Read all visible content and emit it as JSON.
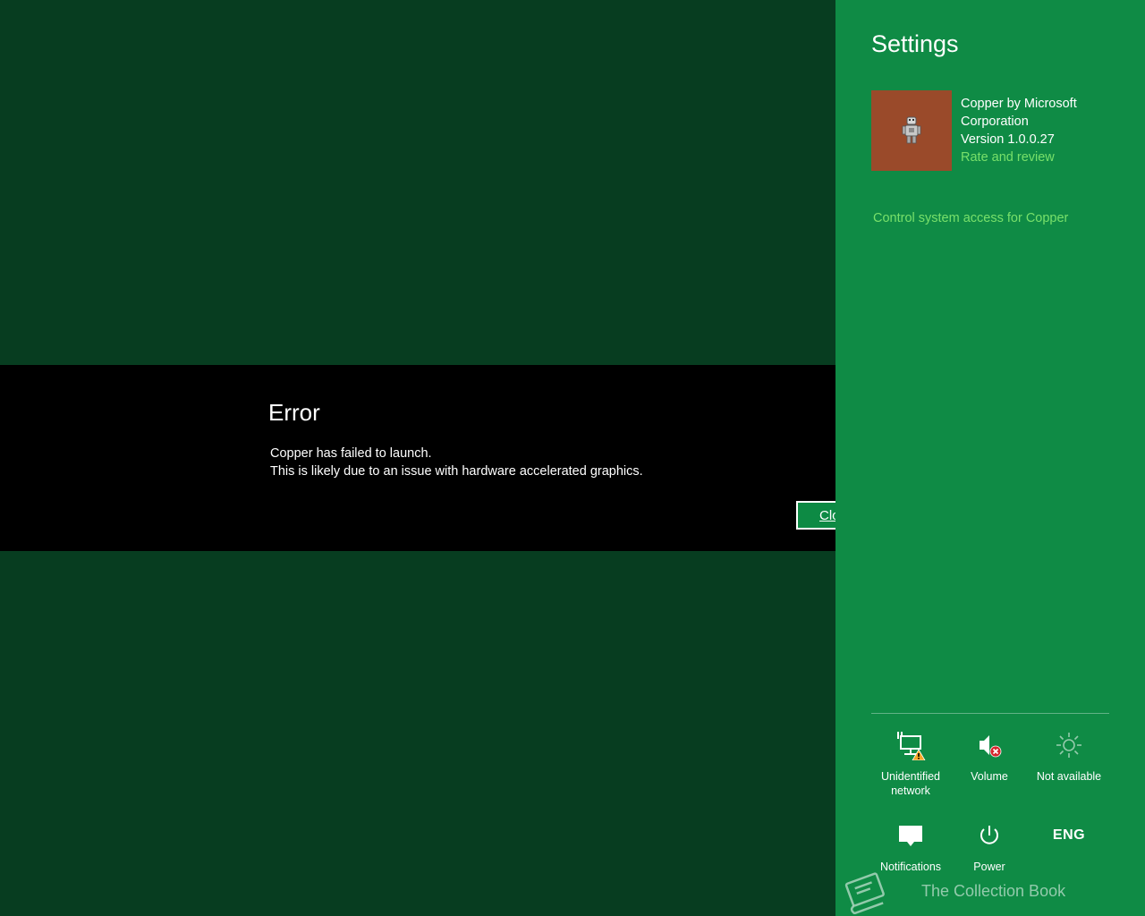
{
  "error_dialog": {
    "title": "Error",
    "message_line1": "Copper has failed to launch.",
    "message_line2": "This is likely due to an issue with hardware accelerated graphics.",
    "close_button_label": "Close"
  },
  "settings": {
    "title": "Settings",
    "app": {
      "name_line1": "Copper by Microsoft",
      "name_line2": "Corporation",
      "version": "Version 1.0.0.27",
      "rate_link": "Rate and review",
      "tile_icon": "robot-icon"
    },
    "access_link": "Control system access for Copper",
    "quick_settings": [
      {
        "label_line1": "Unidentified",
        "label_line2": "network",
        "icon": "network-warning-icon"
      },
      {
        "label_line1": "Volume",
        "label_line2": "",
        "icon": "volume-muted-icon"
      },
      {
        "label_line1": "Not available",
        "label_line2": "",
        "icon": "brightness-icon"
      },
      {
        "label_line1": "Notifications",
        "label_line2": "",
        "icon": "notifications-icon"
      },
      {
        "label_line1": "Power",
        "label_line2": "",
        "icon": "power-icon"
      },
      {
        "label_line1": "",
        "label_line2": "",
        "icon": "keyboard-language",
        "text": "ENG"
      }
    ],
    "watermark": "The Collection Book"
  },
  "colors": {
    "app_background": "#073d20",
    "settings_pane": "#0f8b45",
    "link": "#78e06a",
    "error_band": "#000000",
    "app_tile": "#9a4a2a"
  }
}
